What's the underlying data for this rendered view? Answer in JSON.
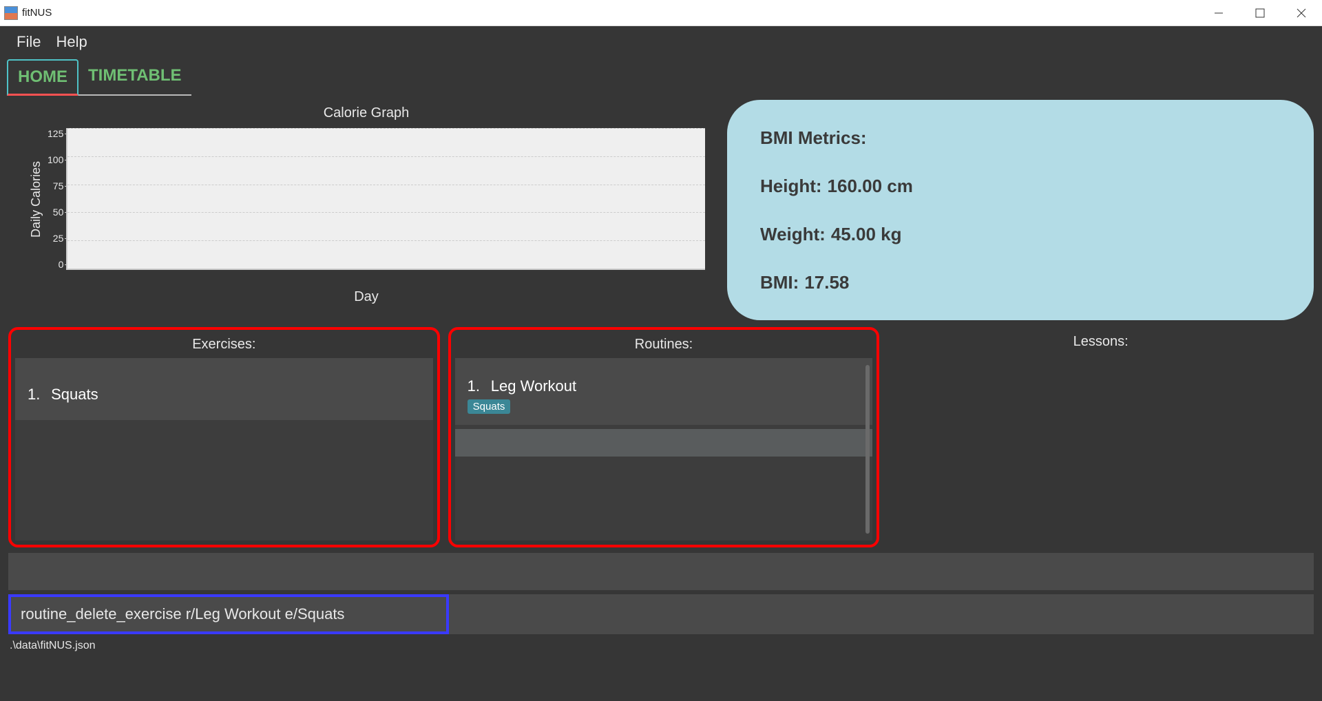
{
  "window": {
    "title": "fitNUS"
  },
  "menu": {
    "file": "File",
    "help": "Help"
  },
  "tabs": {
    "home": "HOME",
    "timetable": "TIMETABLE"
  },
  "chart_data": {
    "type": "bar",
    "title": "Calorie Graph",
    "xlabel": "Day",
    "ylabel": "Daily Calories",
    "ylim": [
      0,
      125
    ],
    "yticks": [
      0,
      25,
      50,
      75,
      100,
      125
    ],
    "categories": [],
    "values": []
  },
  "bmi": {
    "title": "BMI Metrics:",
    "height_label": "Height:",
    "height_value": "160.00 cm",
    "weight_label": "Weight:",
    "weight_value": "45.00 kg",
    "bmi_label": "BMI:",
    "bmi_value": "17.58"
  },
  "panels": {
    "exercises": {
      "title": "Exercises:",
      "items": [
        {
          "index": "1.",
          "name": "Squats"
        }
      ]
    },
    "routines": {
      "title": "Routines:",
      "items": [
        {
          "index": "1.",
          "name": "Leg Workout",
          "tags": [
            "Squats"
          ]
        }
      ]
    },
    "lessons": {
      "title": "Lessons:",
      "items": []
    }
  },
  "command": {
    "value": "routine_delete_exercise r/Leg Workout e/Squats"
  },
  "status": {
    "path": ".\\data\\fitNUS.json"
  }
}
